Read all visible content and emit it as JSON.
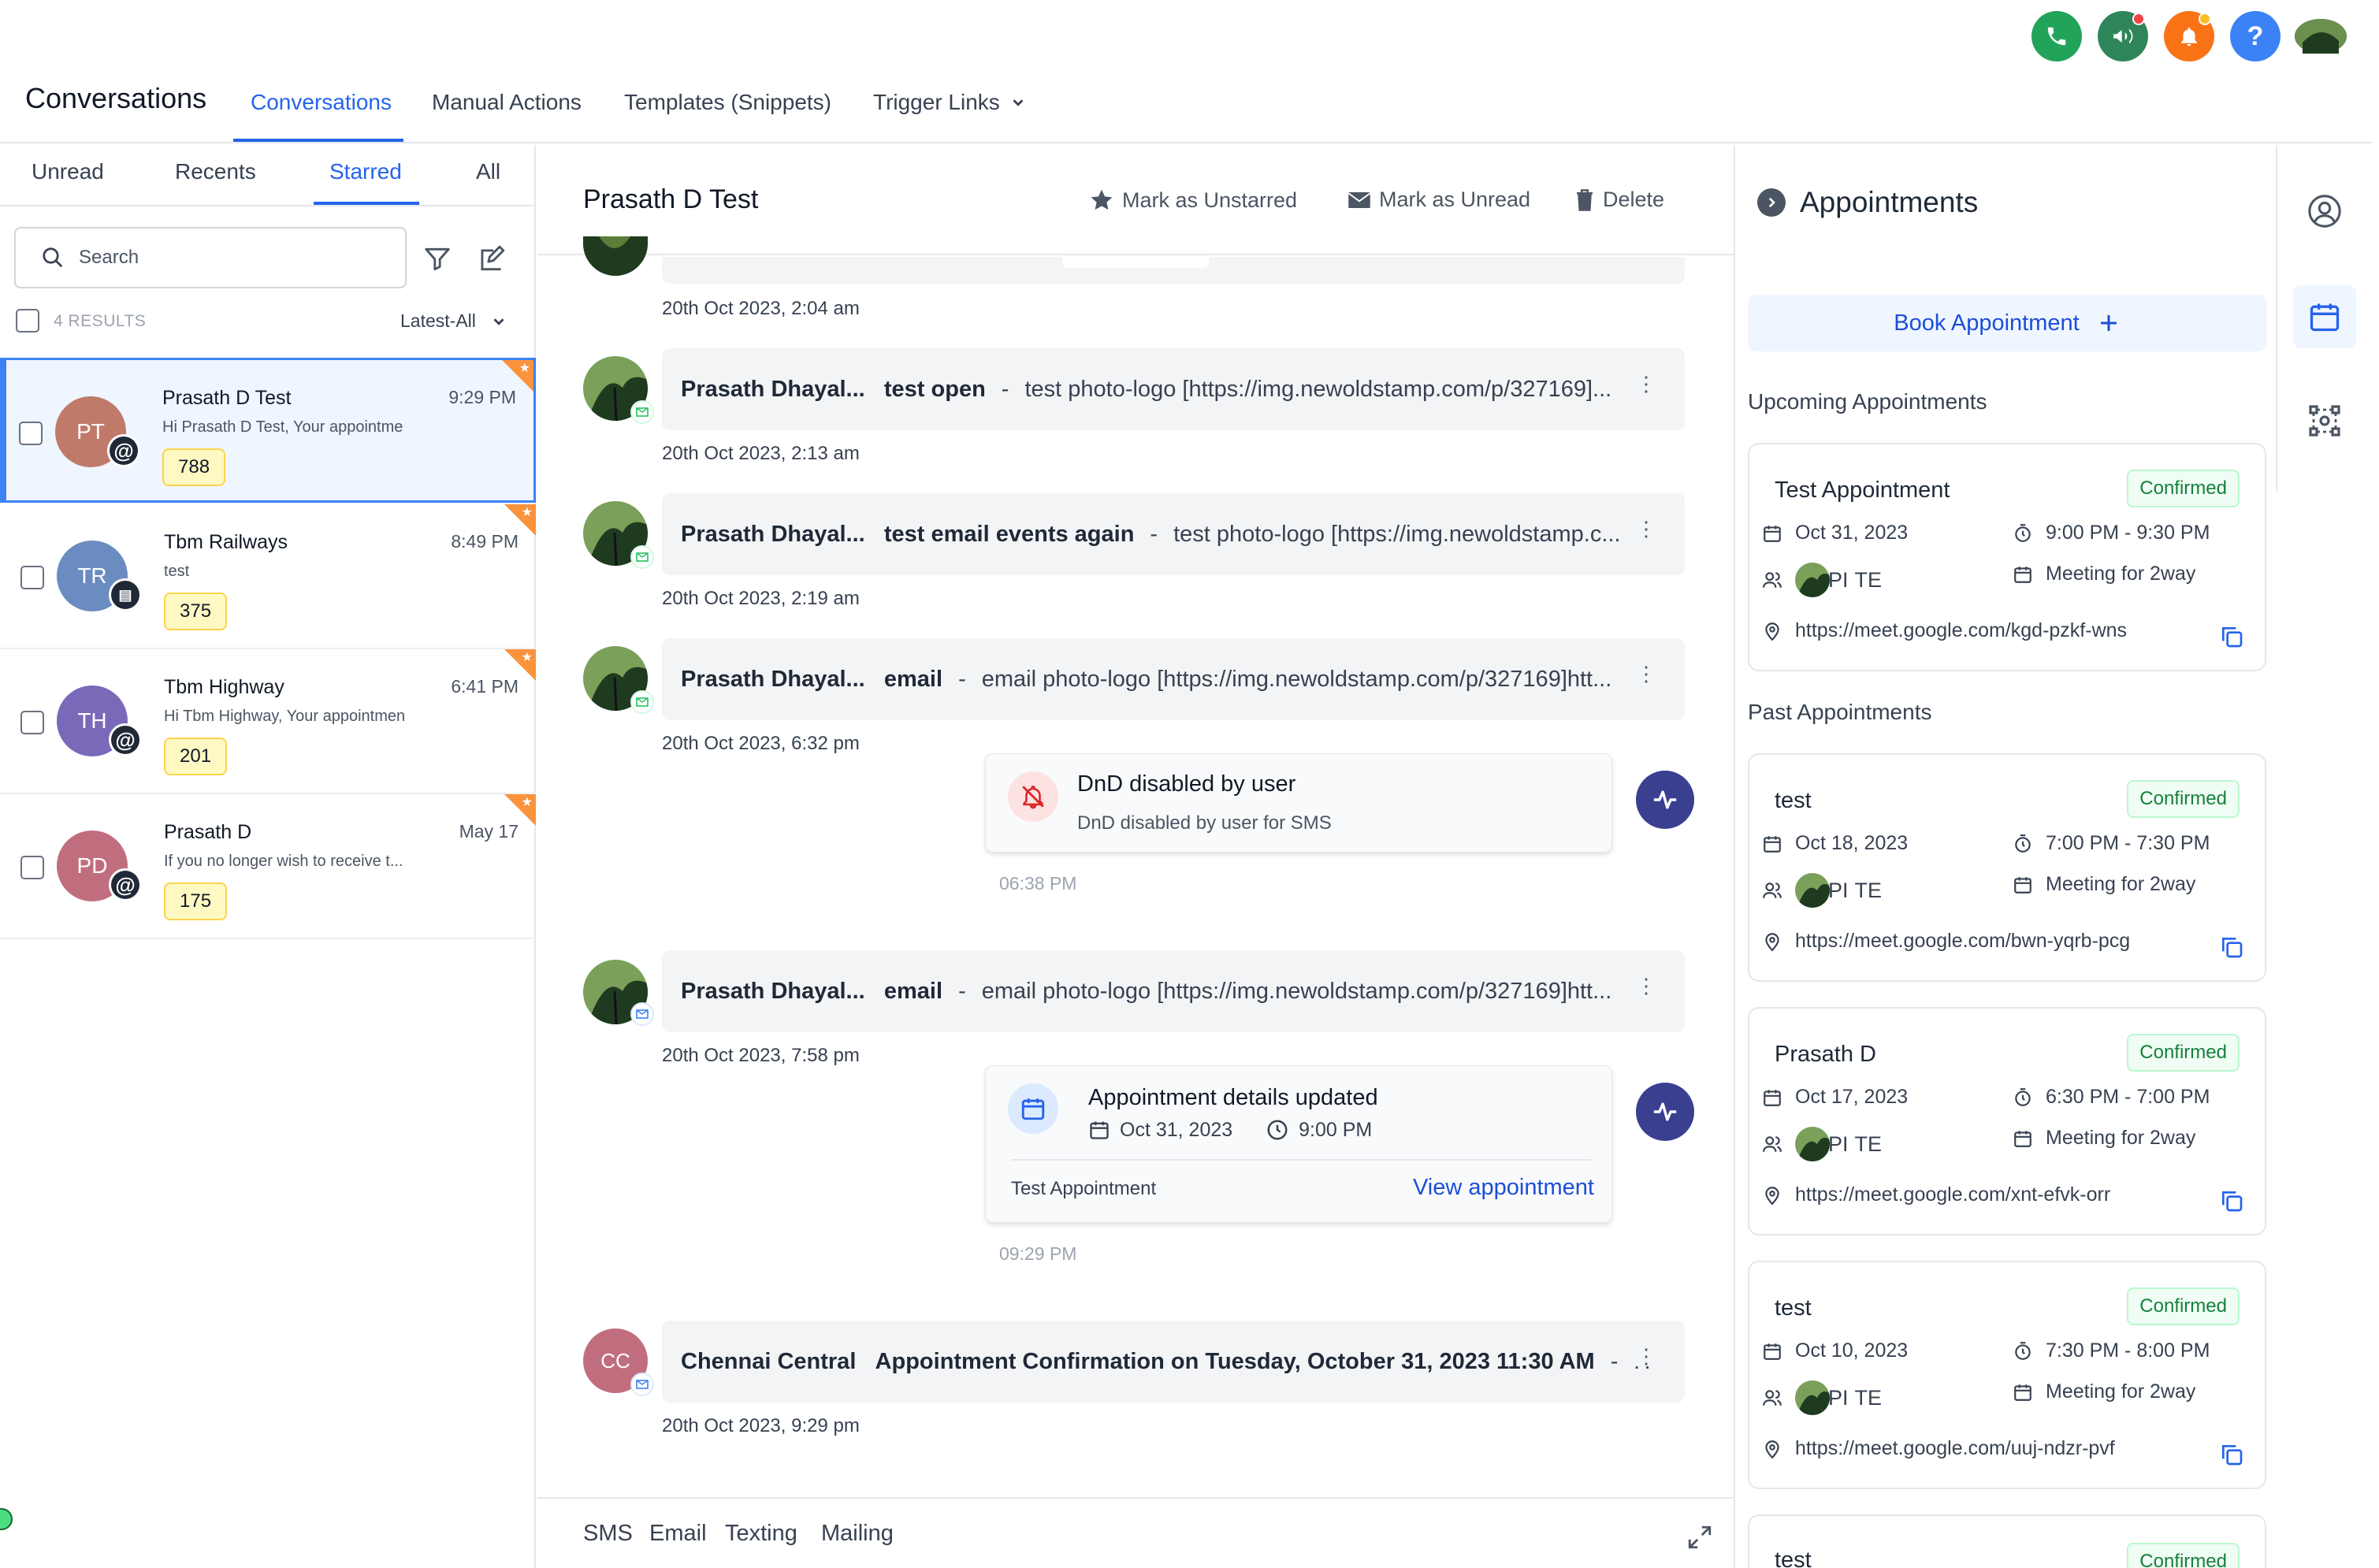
{
  "top_icons": {
    "phone": "phone-icon",
    "announce": "megaphone-icon",
    "notifications": "bell-icon",
    "help": "help-icon",
    "avatar": "user-avatar",
    "colors": {
      "phone": "#22a35a",
      "announce": "#2f855a",
      "bell": "#f97316",
      "help": "#3b82f6"
    }
  },
  "header": {
    "title": "Conversations",
    "tabs": [
      {
        "label": "Conversations",
        "active": true
      },
      {
        "label": "Manual Actions"
      },
      {
        "label": "Templates (Snippets)"
      },
      {
        "label": "Trigger Links"
      }
    ]
  },
  "filters": {
    "tabs": [
      "Unread",
      "Recents",
      "Starred",
      "All"
    ],
    "active": "Starred",
    "search_placeholder": "Search",
    "results": "4 RESULTS",
    "sort": "Latest-All"
  },
  "conversations": [
    {
      "initials": "PT",
      "name": "Prasath D Test",
      "time": "9:29 PM",
      "preview": "Hi Prasath D Test, Your appointme",
      "count": "788",
      "color": "#c07a6a",
      "channel": "@",
      "selected": true
    },
    {
      "initials": "TR",
      "name": "Tbm Railways",
      "time": "8:49 PM",
      "preview": "test",
      "count": "375",
      "color": "#6b8cc0",
      "channel": "sms"
    },
    {
      "initials": "TH",
      "name": "Tbm Highway",
      "time": "6:41 PM",
      "preview": "Hi Tbm Highway, Your appointmen",
      "count": "201",
      "color": "#7a68b8",
      "channel": "@"
    },
    {
      "initials": "PD",
      "name": "Prasath D",
      "time": "May 17",
      "preview": "If you no longer wish to receive t...",
      "count": "175",
      "color": "#c06e7e",
      "channel": "@"
    }
  ],
  "thread": {
    "contact": "Prasath D Test",
    "actions": {
      "unstar": "Mark as Unstarred",
      "unread": "Mark as Unread",
      "delete": "Delete"
    },
    "messages": [
      {
        "time": "20th Oct 2023, 2:04 am"
      },
      {
        "sender": "Prasath Dhayal...",
        "subject": "test open",
        "sep": "-",
        "body": "test photo-logo [https://img.newoldstamp.com/p/327169]...",
        "time": "20th Oct 2023, 2:13 am"
      },
      {
        "sender": "Prasath Dhayal...",
        "subject": "test email events again",
        "sep": "-",
        "body": "test photo-logo [https://img.newoldstamp.c...",
        "time": "20th Oct 2023, 2:19 am"
      },
      {
        "sender": "Prasath Dhayal...",
        "subject": "email",
        "sep": "-",
        "body": "email photo-logo [https://img.newoldstamp.com/p/327169]htt...",
        "time": "20th Oct 2023, 6:32 pm"
      },
      {
        "sender": "Prasath Dhayal...",
        "subject": "email",
        "sep": "-",
        "body": "email photo-logo [https://img.newoldstamp.com/p/327169]htt...",
        "time": "20th Oct 2023, 7:58 pm"
      },
      {
        "initials": "CC",
        "sender": "Chennai Central",
        "subject": "Appointment Confirmation on Tuesday, October 31, 2023 11:30 AM",
        "sep": "-",
        "body": "H",
        "time": "20th Oct 2023, 9:29 pm"
      }
    ],
    "dnd": {
      "title": "DnD disabled by user",
      "subtitle": "DnD disabled by user for SMS",
      "time": "06:38 PM"
    },
    "appt_update": {
      "title": "Appointment details updated",
      "date": "Oct 31, 2023",
      "time": "9:00 PM",
      "name": "Test Appointment",
      "link": "View appointment",
      "stamp": "09:29 PM"
    },
    "composer_tabs": [
      "SMS",
      "Email",
      "Texting",
      "Mailing"
    ]
  },
  "appointments": {
    "title": "Appointments",
    "book": "Book Appointment",
    "upcoming_label": "Upcoming Appointments",
    "past_label": "Past Appointments",
    "upcoming": [
      {
        "title": "Test Appointment",
        "status": "Confirmed",
        "date": "Oct 31, 2023",
        "time": "9:00 PM - 9:30 PM",
        "initials": "PI",
        "initials2": "TE",
        "calendar": "Meeting for 2way",
        "link": "https://meet.google.com/kgd-pzkf-wns"
      }
    ],
    "past": [
      {
        "title": "test",
        "status": "Confirmed",
        "date": "Oct 18, 2023",
        "time": "7:00 PM - 7:30 PM",
        "initials": "PI",
        "initials2": "TE",
        "calendar": "Meeting for 2way",
        "link": "https://meet.google.com/bwn-yqrb-pcg"
      },
      {
        "title": "Prasath D",
        "status": "Confirmed",
        "date": "Oct 17, 2023",
        "time": "6:30 PM - 7:00 PM",
        "initials": "PI",
        "initials2": "TE",
        "calendar": "Meeting for 2way",
        "link": "https://meet.google.com/xnt-efvk-orr"
      },
      {
        "title": "test",
        "status": "Confirmed",
        "date": "Oct 10, 2023",
        "time": "7:30 PM - 8:00 PM",
        "initials": "PI",
        "initials2": "TE",
        "calendar": "Meeting for 2way",
        "link": "https://meet.google.com/uuj-ndzr-pvf"
      },
      {
        "title": "test",
        "status": "Confirmed"
      }
    ]
  }
}
